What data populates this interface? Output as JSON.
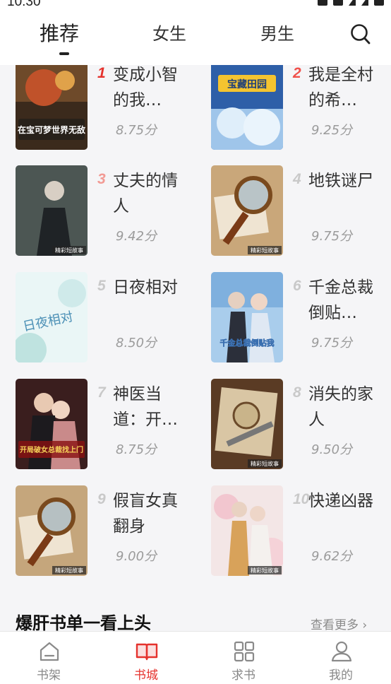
{
  "status": {
    "time": "10:30"
  },
  "tabs": [
    {
      "label": "推荐",
      "active": true
    },
    {
      "label": "女生",
      "active": false
    },
    {
      "label": "男生",
      "active": false
    }
  ],
  "books": [
    {
      "rank": "1",
      "title": "变成小智的我…",
      "score": "8.75分",
      "cover_text": "在宝可梦世界无敌"
    },
    {
      "rank": "2",
      "title": "我是全村的希…",
      "score": "9.25分",
      "cover_text": "宝藏田园"
    },
    {
      "rank": "3",
      "title": "丈夫的情人",
      "score": "9.42分",
      "cover_text": "精彩短故事"
    },
    {
      "rank": "4",
      "title": "地铁谜尸",
      "score": "9.75分",
      "cover_text": "精彩短故事"
    },
    {
      "rank": "5",
      "title": "日夜相对",
      "score": "8.50分",
      "cover_text": "日夜相对"
    },
    {
      "rank": "6",
      "title": "千金总裁倒贴…",
      "score": "9.75分",
      "cover_text": "千金总裁倒贴我"
    },
    {
      "rank": "7",
      "title": "神医当道：开…",
      "score": "8.75分",
      "cover_text": "开局破女总裁找上门"
    },
    {
      "rank": "8",
      "title": "消失的家人",
      "score": "9.50分",
      "cover_text": "精彩短故事"
    },
    {
      "rank": "9",
      "title": "假盲女真翻身",
      "score": "9.00分",
      "cover_text": "精彩短故事"
    },
    {
      "rank": "10",
      "title": "快递凶器",
      "score": "9.62分",
      "cover_text": "精彩短故事"
    }
  ],
  "section": {
    "title": "爆肝书单一看上头",
    "more": "查看更多 ›"
  },
  "bottom_nav": [
    {
      "label": "书架",
      "icon": "bookshelf-icon",
      "active": false
    },
    {
      "label": "书城",
      "icon": "open-book-icon",
      "active": true
    },
    {
      "label": "求书",
      "icon": "grid-icon",
      "active": false
    },
    {
      "label": "我的",
      "icon": "person-icon",
      "active": false
    }
  ],
  "colors": {
    "accent": "#e5322d",
    "background": "#f5f5f7"
  }
}
